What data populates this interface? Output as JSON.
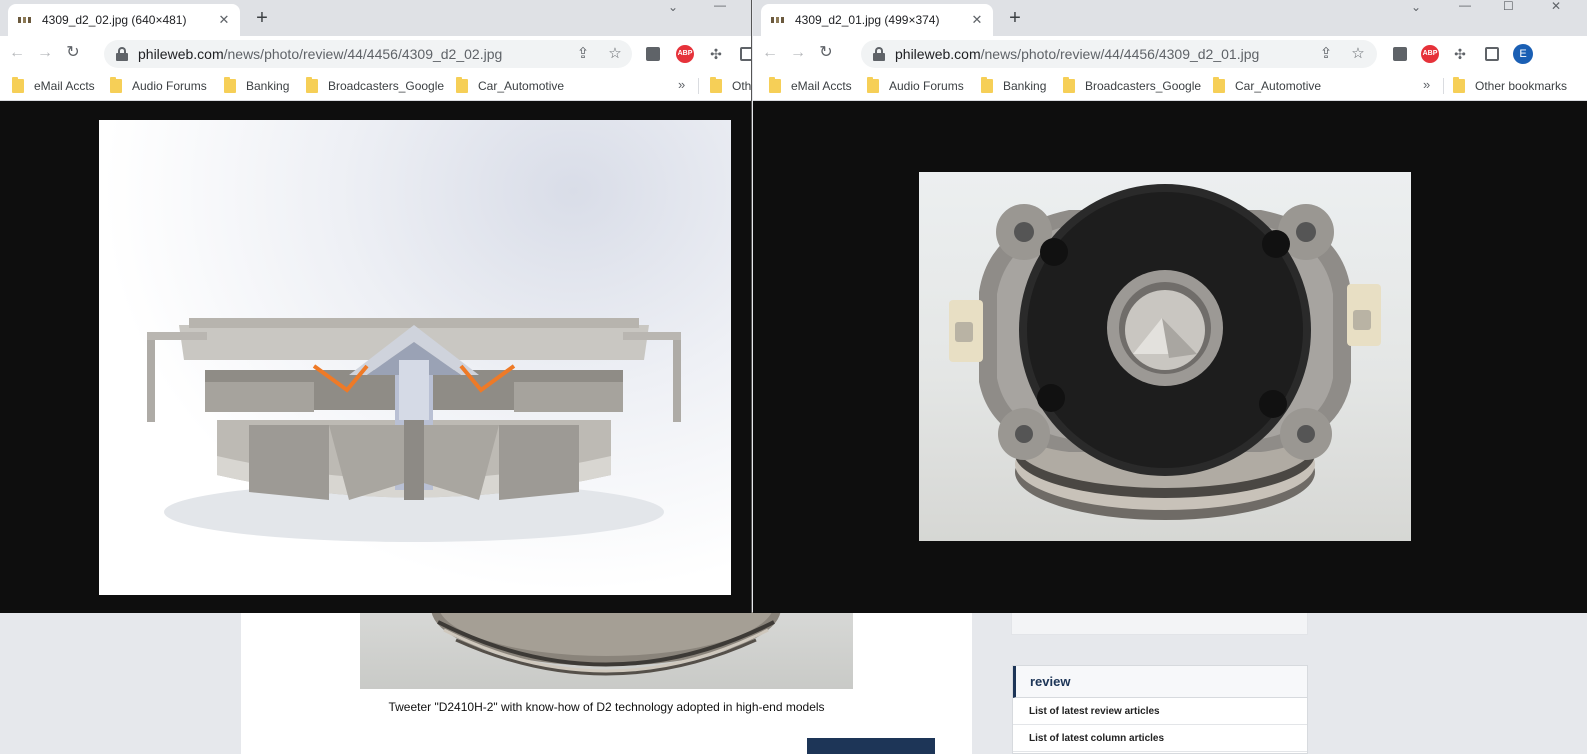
{
  "background_page": {
    "caption": "Tweeter \"D2410H-2\" with know-how of D2 technology adopted in high-end models",
    "side_nav": {
      "title": "review",
      "items": [
        "List of latest review articles",
        "List of latest column articles"
      ]
    }
  },
  "windows": [
    {
      "tab_title": "4309_d2_02.jpg (640×481)",
      "url_host": "phileweb.com",
      "url_path": "/news/photo/review/44/4456/4309_d2_02.jpg",
      "bookmarks": [
        "eMail Accts",
        "Audio Forums",
        "Banking",
        "Broadcasters_Google",
        "Car_Automotive",
        "Oth"
      ],
      "image_alt": "Cutaway render of tweeter"
    },
    {
      "tab_title": "4309_d2_01.jpg (499×374)",
      "url_host": "phileweb.com",
      "url_path": "/news/photo/review/44/4456/4309_d2_01.jpg",
      "bookmarks": [
        "eMail Accts",
        "Audio Forums",
        "Banking",
        "Broadcasters_Google",
        "Car_Automotive",
        "Other bookmarks"
      ],
      "avatar_letter": "E",
      "image_alt": "Photo of tweeter front"
    }
  ],
  "icons": {
    "back": "←",
    "forward": "→",
    "reload": "↻",
    "close": "✕",
    "new_tab": "+",
    "share": "⇪",
    "star": "☆",
    "puzzle": "✣",
    "chevron_more": "»",
    "minimize": "—",
    "maximize": "☐",
    "chevron_down": "⌄",
    "abp": "ABP"
  },
  "colors": {
    "accent_navy": "#1d3557",
    "abp_red": "#e6323a",
    "folder": "#f6cf57",
    "avatar": "#1a5fb4"
  }
}
